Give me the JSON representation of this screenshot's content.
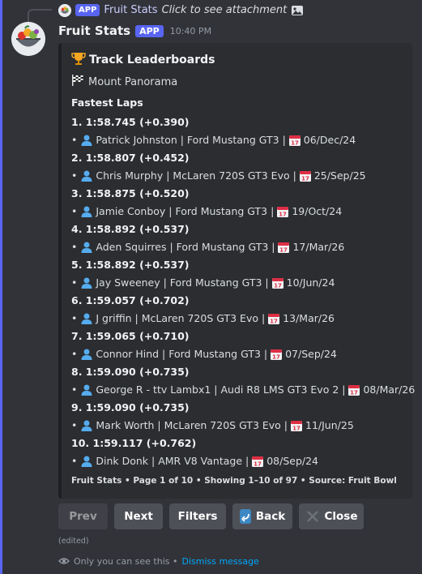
{
  "reply": {
    "name": "Fruit Stats",
    "badge": "APP",
    "text": "Click to see attachment"
  },
  "message": {
    "author": "Fruit Stats",
    "badge": "APP",
    "timestamp": "10:40 PM"
  },
  "embed": {
    "title": "Track Leaderboards",
    "track": "Mount Panorama",
    "field_name": "Fastest Laps",
    "laps": [
      {
        "time": "1. 1:58.745 (+0.390)",
        "driver": "Patrick Johnston | Ford Mustang GT3 |",
        "date": "06/Dec/24"
      },
      {
        "time": "2. 1:58.807 (+0.452)",
        "driver": "Chris Murphy | McLaren 720S GT3 Evo |",
        "date": "25/Sep/25"
      },
      {
        "time": "3. 1:58.875 (+0.520)",
        "driver": "Jamie Conboy | Ford Mustang GT3 |",
        "date": "19/Oct/24"
      },
      {
        "time": "4. 1:58.892 (+0.537)",
        "driver": "Aden Squirres | Ford Mustang GT3 |",
        "date": "17/Mar/26"
      },
      {
        "time": "5. 1:58.892 (+0.537)",
        "driver": "Jay Sweeney | Ford Mustang GT3 |",
        "date": "10/Jun/24"
      },
      {
        "time": "6. 1:59.057 (+0.702)",
        "driver": "J griffin | McLaren 720S GT3 Evo |",
        "date": "13/Mar/26"
      },
      {
        "time": "7. 1:59.065 (+0.710)",
        "driver": "Connor Hind | Ford Mustang GT3 |",
        "date": "07/Sep/24"
      },
      {
        "time": "8. 1:59.090 (+0.735)",
        "driver": "George R - ttv Lambx1 | Audi R8 LMS GT3 Evo 2 |",
        "date": "08/Mar/26"
      },
      {
        "time": "9. 1:59.090 (+0.735)",
        "driver": "Mark Worth | McLaren 720S GT3 Evo |",
        "date": "11/Jun/25"
      },
      {
        "time": "10. 1:59.117 (+0.762)",
        "driver": "Dink Donk | AMR V8 Vantage |",
        "date": "08/Sep/24"
      }
    ],
    "footer": "Fruit Stats • Page 1 of 10 • Showing 1–10 of 97 • Source: Fruit Bowl"
  },
  "buttons": {
    "prev": "Prev",
    "next": "Next",
    "filters": "Filters",
    "back": "Back",
    "close": "Close"
  },
  "edited": "(edited)",
  "ephemeral": {
    "text": "Only you can see this •",
    "dismiss": "Dismiss message"
  },
  "icons": {
    "trophy": "trophy-icon",
    "flag": "checkered-flag-icon",
    "person": "person-silhouette-icon",
    "calendar": "calendar-icon",
    "back": "back-arrow-icon",
    "close": "close-x-icon",
    "eye": "eye-icon",
    "image": "image-icon"
  },
  "colors": {
    "background": "#323339",
    "accent": "#5865f2",
    "link": "#00a8fc",
    "embed": "#2b2d31",
    "button": "#4e5058"
  }
}
